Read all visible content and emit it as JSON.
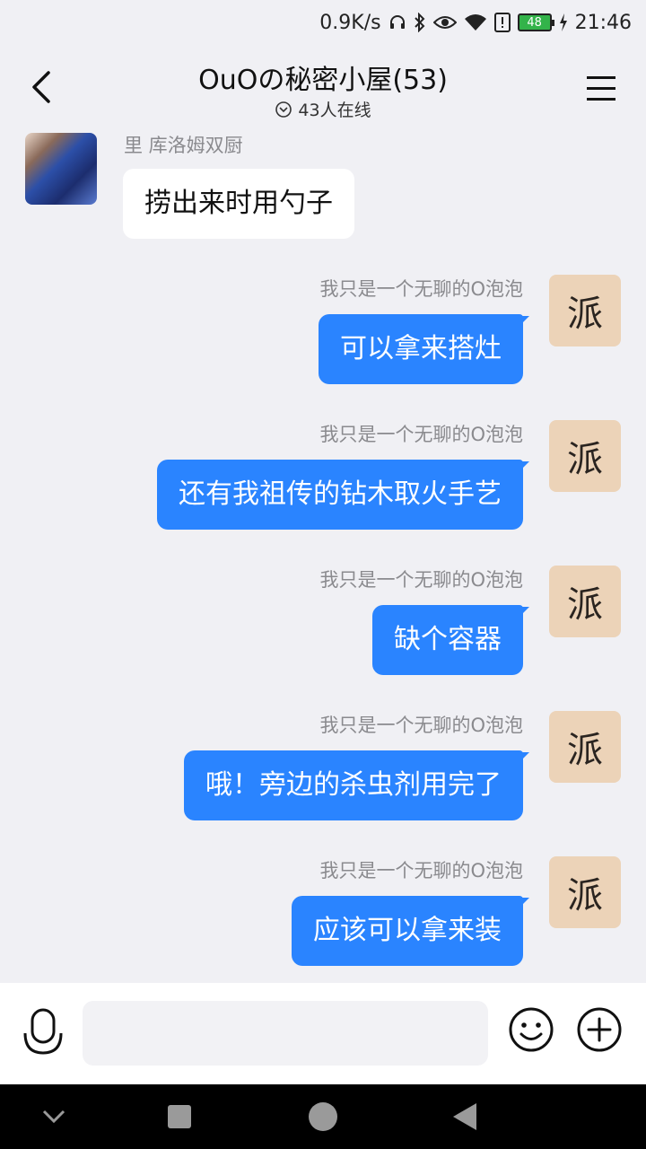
{
  "status_bar": {
    "net_speed": "0.9K/s",
    "battery_level": "48",
    "time": "21:46",
    "icons": [
      "headset-icon",
      "bluetooth-icon",
      "eye-icon",
      "wifi-icon",
      "alert-icon",
      "battery-icon",
      "charging-icon"
    ]
  },
  "header": {
    "title": "OuOの秘密小屋(53)",
    "online": "43人在线"
  },
  "messages": [
    {
      "side": "left",
      "sender": "里 库洛姆双厨",
      "text": "捞出来时用勺子"
    },
    {
      "side": "right",
      "sender": "我只是一个无聊的O泡泡",
      "text": "可以拿来搭灶",
      "avatar_char": "派"
    },
    {
      "side": "right",
      "sender": "我只是一个无聊的O泡泡",
      "text": "还有我祖传的钻木取火手艺",
      "avatar_char": "派"
    },
    {
      "side": "right",
      "sender": "我只是一个无聊的O泡泡",
      "text": "缺个容器",
      "avatar_char": "派"
    },
    {
      "side": "right",
      "sender": "我只是一个无聊的O泡泡",
      "text": "哦！旁边的杀虫剂用完了",
      "avatar_char": "派"
    },
    {
      "side": "right",
      "sender": "我只是一个无聊的O泡泡",
      "text": "应该可以拿来装",
      "avatar_char": "派"
    }
  ],
  "input": {
    "placeholder": "",
    "value": ""
  },
  "colors": {
    "accent": "#2a84ff",
    "background": "#f0f0f4",
    "bubble_left": "#ffffff"
  }
}
